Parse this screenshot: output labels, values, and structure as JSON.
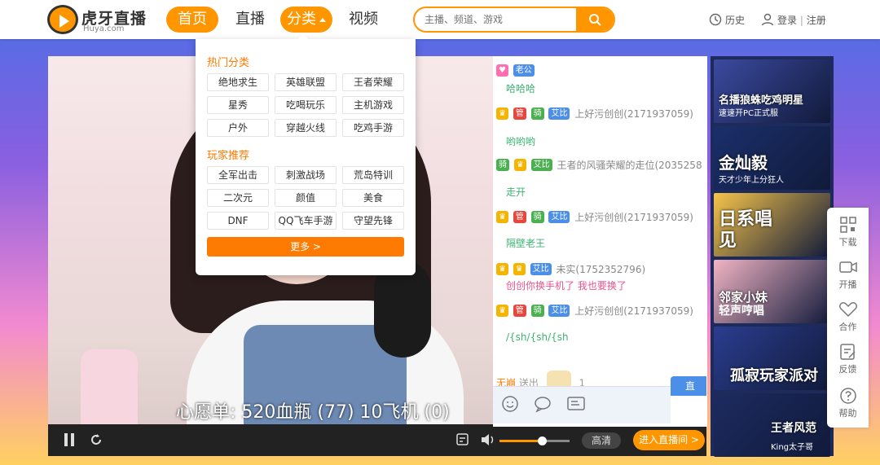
{
  "header": {
    "logo_text": "虎牙直播",
    "logo_sub": "Huya.com",
    "nav": [
      {
        "label": "首页",
        "active": true
      },
      {
        "label": "直播",
        "active": false
      },
      {
        "label": "分类",
        "active": true
      },
      {
        "label": "视频",
        "active": false
      }
    ],
    "search_placeholder": "主播、频道、游戏",
    "history_label": "历史",
    "login_label": "登录",
    "separator": "|",
    "register_label": "注册"
  },
  "dropdown": {
    "hot_title": "热门分类",
    "hot_items": [
      "绝地求生",
      "英雄联盟",
      "王者荣耀",
      "星秀",
      "吃喝玩乐",
      "主机游戏",
      "户外",
      "穿越火线",
      "吃鸡手游"
    ],
    "rec_title": "玩家推荐",
    "rec_items": [
      "全军出击",
      "刺激战场",
      "荒岛特训",
      "二次元",
      "颜值",
      "美食",
      "DNF",
      "QQ飞车手游",
      "守望先锋"
    ],
    "more_label": "更多 >"
  },
  "player": {
    "caption": "心愿单: 520血瓶 (77) 10飞机 (0)",
    "quality_label": "高清",
    "enter_label": "进入直播间 >",
    "volume": 0.6
  },
  "chat": {
    "messages": [
      {
        "badges": [
          "♥",
          "老公"
        ],
        "user": "",
        "text": "哈哈哈",
        "text_color": "#3cb371"
      },
      {
        "badges": [
          "♛",
          "管",
          "骑",
          "艾比"
        ],
        "user": "上好污创创(2171937059)",
        "text": "哟哟哟",
        "text_color": "#3cb371"
      },
      {
        "badges": [
          "骑",
          "♛",
          "艾比"
        ],
        "user": "王者的风骚荣耀的走位(2035258",
        "text": "走开",
        "text_color": "#3cb371"
      },
      {
        "badges": [
          "♛",
          "管",
          "骑",
          "艾比"
        ],
        "user": "上好污创创(2171937059)",
        "text": "隔壁老王",
        "text_color": "#3cb371"
      },
      {
        "badges": [
          "♛",
          "♛",
          "艾比"
        ],
        "user": "未实(1752352796)",
        "text": "创创你换手机了 我也要换了",
        "text_color": "#e8558e"
      },
      {
        "badges": [
          "♛",
          "管",
          "骑",
          "艾比"
        ],
        "user": "上好污创创(2171937059)",
        "text": "/{sh/{sh/{sh",
        "text_color": "#3cb371"
      }
    ],
    "gift": {
      "user": "无崩",
      "action": "送出",
      "count": "1"
    },
    "side_tab": "直"
  },
  "recommend": [
    {
      "title": "名播狼蛛吃鸡明星",
      "sub": "速速开PC正式服",
      "color": "#3b4aa0"
    },
    {
      "title": "金灿毅",
      "sub": "天才少年上分狂人",
      "color": "#1a2f6b"
    },
    {
      "title": "日系唱见",
      "sub": "",
      "color": "#f6c44a"
    },
    {
      "title": "邻家小妹",
      "sub": "轻声哼唱",
      "color": "#f2b4c4"
    },
    {
      "title": "孤寂玩家派对",
      "sub": "",
      "color": "#2a3d8f"
    },
    {
      "title": "王者风范",
      "sub": "King太子哥",
      "color": "#1c2b60"
    }
  ],
  "rightbar": [
    {
      "label": "下载",
      "icon": "qrcode-icon"
    },
    {
      "label": "开播",
      "icon": "camera-icon"
    },
    {
      "label": "合作",
      "icon": "handshake-icon"
    },
    {
      "label": "反馈",
      "icon": "edit-icon"
    },
    {
      "label": "帮助",
      "icon": "help-icon"
    }
  ],
  "colors": {
    "brand": "#ff9600",
    "accent_orange": "#ff7a00"
  }
}
